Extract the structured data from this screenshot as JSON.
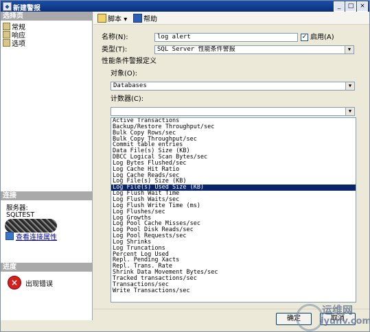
{
  "window": {
    "title": "新建警报",
    "min": "_",
    "max": "□",
    "close": "×"
  },
  "left": {
    "select_page_header": "选择页",
    "pages": [
      "常规",
      "响应",
      "选项"
    ],
    "connection_header": "连接",
    "server_label": "服务器:",
    "server_value": "SQLTEST",
    "view_connection_props": "查看连接属性",
    "progress_header": "进度",
    "progress_status": "出现错误"
  },
  "toolbar": {
    "script_label": "脚本",
    "dropdown_glyph": "▾",
    "help_label": "帮助"
  },
  "form": {
    "name_label": "名称(N):",
    "name_value": "log alert",
    "enabled_label": "启用(A)",
    "enabled_checked": true,
    "type_label": "类型(T):",
    "type_value": "SQL Server 性能条件警报",
    "perf_condition_label": "性能条件警报定义",
    "object_label": "对象(O):",
    "object_value": "Databases",
    "counter_label": "计数器(C):",
    "counter_value": "",
    "counter_options": [
      "Active Transactions",
      "Backup/Restore Throughput/sec",
      "Bulk Copy Rows/sec",
      "Bulk Copy Throughput/sec",
      "Commit table entries",
      "Data File(s) Size (KB)",
      "DBCC Logical Scan Bytes/sec",
      "Log Bytes Flushed/sec",
      "Log Cache Hit Ratio",
      "Log Cache Reads/sec",
      "Log File(s) Size (KB)",
      "Log File(s) Used Size (KB)",
      "Log Flush Wait Time",
      "Log Flush Waits/sec",
      "Log Flush Write Time (ms)",
      "Log Flushes/sec",
      "Log Growths",
      "Log Pool Cache Misses/sec",
      "Log Pool Disk Reads/sec",
      "Log Pool Requests/sec",
      "Log Shrinks",
      "Log Truncations",
      "Percent Log Used",
      "Repl. Pending Xacts",
      "Repl. Trans. Rate",
      "Shrink Data Movement Bytes/sec",
      "Tracked transactions/sec",
      "Transactions/sec",
      "Write Transactions/sec"
    ],
    "selected_option": "Log File(s) Used Size (KB)"
  },
  "buttons": {
    "ok": "确定",
    "cancel": "取消"
  },
  "watermark": {
    "line1": "运维网",
    "line2": "iyunv.com"
  }
}
